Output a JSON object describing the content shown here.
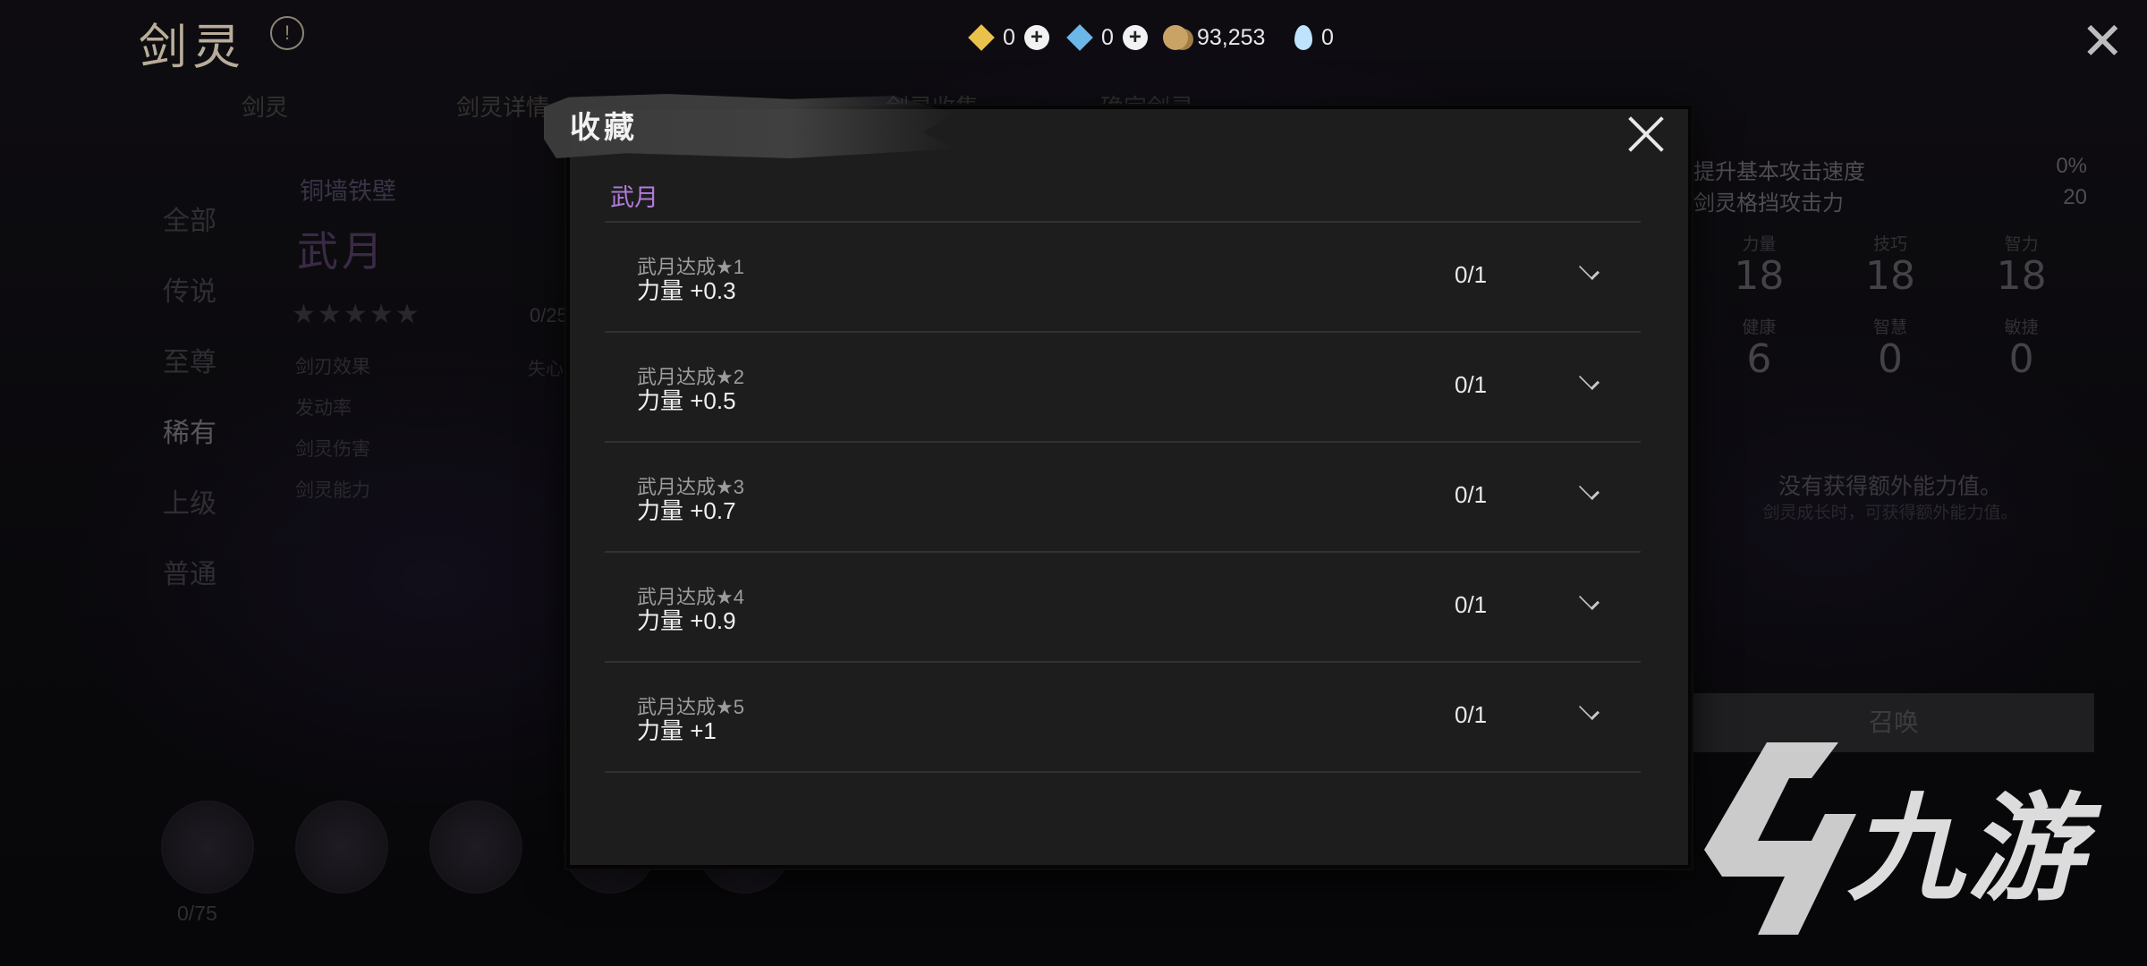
{
  "app": {
    "title": "剑灵"
  },
  "currencies": [
    {
      "icon": "gold-gem-icon",
      "value": "0"
    },
    {
      "icon": "blue-gem-icon",
      "value": "0"
    },
    {
      "icon": "coin-icon",
      "value": "93,253"
    },
    {
      "icon": "water-drop-icon",
      "value": "0"
    }
  ],
  "background": {
    "tabs": [
      "剑灵",
      "剑灵详情",
      "",
      "剑灵收集",
      "确定剑灵"
    ],
    "left_menu": [
      "全部",
      "传说",
      "至尊",
      "稀有",
      "上级",
      "普通"
    ],
    "active_menu": "稀有",
    "sub_title": "铜墙铁壁",
    "spirit_name": "武月",
    "progress": "0/25",
    "props": [
      "剑刃效果",
      "发动率",
      "剑灵伤害",
      "剑灵能力"
    ],
    "prop_side": "失心",
    "right_stats": [
      {
        "label": "提升基本攻击速度",
        "value": "0%"
      },
      {
        "label": "剑灵格挡攻击力",
        "value": "20"
      }
    ],
    "attributes": [
      {
        "label": "力量",
        "value": "18"
      },
      {
        "label": "技巧",
        "value": "18"
      },
      {
        "label": "智力",
        "value": "18"
      },
      {
        "label": "健康",
        "value": "6"
      },
      {
        "label": "智慧",
        "value": "0"
      },
      {
        "label": "敏捷",
        "value": "0"
      }
    ],
    "no_extra": "没有获得额外能力值。",
    "no_extra_sub": "剑灵成长时，可获得额外能力值。",
    "summon_label": "召唤",
    "collection_count": "0/75"
  },
  "modal": {
    "title": "收藏",
    "section": "武月",
    "items": [
      {
        "name": "武月达成★1",
        "reward": "力量 +0.3",
        "progress": "0/1"
      },
      {
        "name": "武月达成★2",
        "reward": "力量 +0.5",
        "progress": "0/1"
      },
      {
        "name": "武月达成★3",
        "reward": "力量 +0.7",
        "progress": "0/1"
      },
      {
        "name": "武月达成★4",
        "reward": "力量 +0.9",
        "progress": "0/1"
      },
      {
        "name": "武月达成★5",
        "reward": "力量 +1",
        "progress": "0/1"
      }
    ]
  },
  "watermark": {
    "text": "九游"
  }
}
